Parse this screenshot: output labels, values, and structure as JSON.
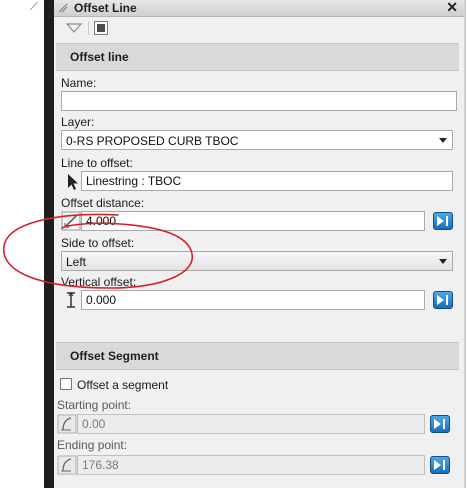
{
  "window": {
    "title": "Offset Line",
    "close_glyph": "✕"
  },
  "sections": {
    "offset_line": "Offset line",
    "offset_segment": "Offset Segment"
  },
  "fields": {
    "name_label": "Name:",
    "name_value": "",
    "layer_label": "Layer:",
    "layer_value": "0-RS PROPOSED CURB TBOC",
    "line_to_offset_label": "Line to offset:",
    "line_to_offset_value": "Linestring : TBOC",
    "offset_distance_label": "Offset distance:",
    "offset_distance_value": "4.000",
    "side_to_offset_label": "Side to offset:",
    "side_to_offset_value": "Left",
    "vertical_offset_label": "Vertical offset:",
    "vertical_offset_value": "0.000",
    "offset_segment_checkbox_label": "Offset a segment",
    "offset_segment_checked": false,
    "starting_point_label": "Starting point:",
    "starting_point_value": "0.00",
    "ending_point_label": "Ending point:",
    "ending_point_value": "176.38"
  },
  "icons": {
    "toolbar_dropdown": "triangle-down-icon",
    "toolbar_button": "square-icon",
    "pick": "cursor-arrow-icon",
    "distance": "distance-icon",
    "vertical": "vertical-offset-icon",
    "lock": "lock-play-icon"
  },
  "colors": {
    "annotation": "#d4202a",
    "lock_button": "#1a6fb8",
    "panel": "#f0f0f0",
    "section_header": "#d9d9d9"
  }
}
